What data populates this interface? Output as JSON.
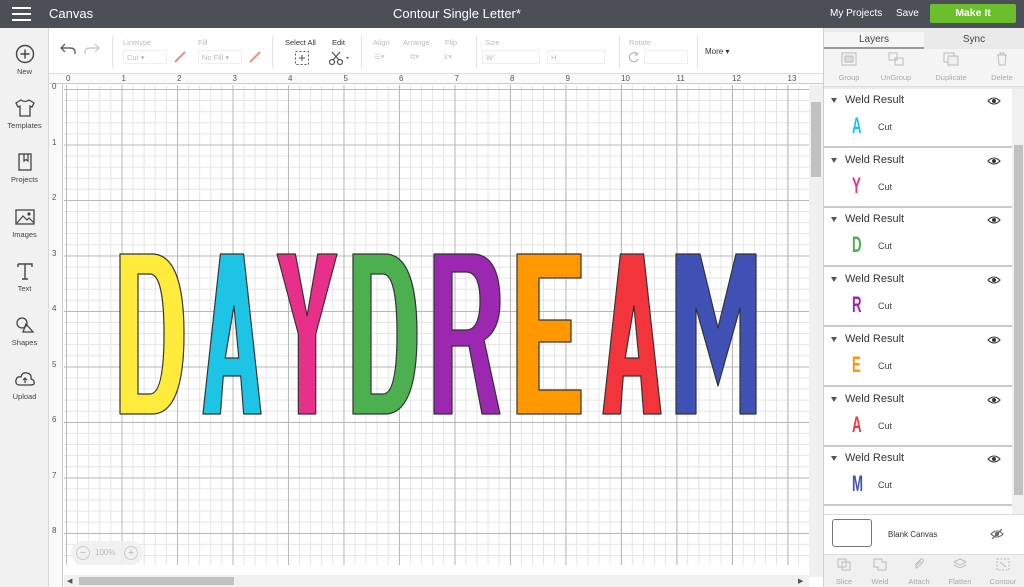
{
  "topbar": {
    "app_title": "Canvas",
    "document_title": "Contour Single Letter*",
    "my_projects": "My Projects",
    "save": "Save",
    "make_it": "Make It"
  },
  "sidebar": {
    "items": [
      {
        "label": "New",
        "icon": "plus-circle-icon"
      },
      {
        "label": "Templates",
        "icon": "shirt-icon"
      },
      {
        "label": "Projects",
        "icon": "bookmark-book-icon"
      },
      {
        "label": "Images",
        "icon": "image-icon"
      },
      {
        "label": "Text",
        "icon": "text-t-icon"
      },
      {
        "label": "Shapes",
        "icon": "shapes-icon"
      },
      {
        "label": "Upload",
        "icon": "cloud-upload-icon"
      }
    ]
  },
  "toolbar": {
    "linetype_label": "Linetype",
    "linetype_value": "Cut",
    "fill_label": "Fill",
    "fill_value": "No Fill",
    "select_all": "Select All",
    "edit": "Edit",
    "align": "Align",
    "arrange": "Arrange",
    "flip": "Flip",
    "size": "Size",
    "size_w": "W",
    "size_h": "H",
    "rotate": "Rotate",
    "more": "More"
  },
  "rulers": {
    "top": [
      "0",
      "1",
      "2",
      "3",
      "4",
      "5",
      "6",
      "7",
      "8",
      "9",
      "10",
      "11",
      "12",
      "13"
    ],
    "left": [
      "0",
      "1",
      "2",
      "3",
      "4",
      "5",
      "6",
      "7",
      "8"
    ]
  },
  "canvas": {
    "letters": [
      {
        "char": "D",
        "color": "#ffeb3b"
      },
      {
        "char": "A",
        "color": "#1ec4e6"
      },
      {
        "char": "Y",
        "color": "#e8308a"
      },
      {
        "char": "D",
        "color": "#4caf50"
      },
      {
        "char": "R",
        "color": "#9c27b0"
      },
      {
        "char": "E",
        "color": "#ff9800"
      },
      {
        "char": "A",
        "color": "#f2353a"
      },
      {
        "char": "M",
        "color": "#3f51b5"
      }
    ],
    "zoom": "100%"
  },
  "panel": {
    "tabs": [
      "Layers",
      "Sync"
    ],
    "tools": [
      "Group",
      "UnGroup",
      "Duplicate",
      "Delete"
    ],
    "layers": [
      {
        "name": "Weld Result",
        "letter": "A",
        "color": "#1ec4e6",
        "operation": "Cut"
      },
      {
        "name": "Weld Result",
        "letter": "Y",
        "color": "#e8308a",
        "operation": "Cut"
      },
      {
        "name": "Weld Result",
        "letter": "D",
        "color": "#4caf50",
        "operation": "Cut"
      },
      {
        "name": "Weld Result",
        "letter": "R",
        "color": "#9c27b0",
        "operation": "Cut"
      },
      {
        "name": "Weld Result",
        "letter": "E",
        "color": "#ff9800",
        "operation": "Cut"
      },
      {
        "name": "Weld Result",
        "letter": "A",
        "color": "#f2353a",
        "operation": "Cut"
      },
      {
        "name": "Weld Result",
        "letter": "M",
        "color": "#3f51b5",
        "operation": "Cut"
      }
    ],
    "blank_canvas": "Blank Canvas",
    "bottom_tools": [
      "Slice",
      "Weld",
      "Attach",
      "Flatten",
      "Contour"
    ]
  },
  "colors": {
    "topbar_bg": "#4a5056",
    "make_it_bg": "#6bbf2c"
  }
}
